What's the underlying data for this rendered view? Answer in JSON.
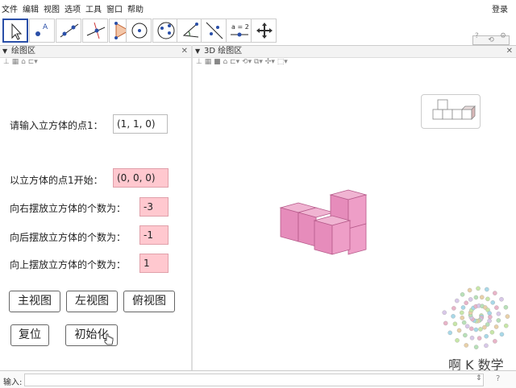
{
  "menu": [
    "文件",
    "编辑",
    "视图",
    "选项",
    "工具",
    "窗口",
    "帮助"
  ],
  "login_label": "登录",
  "toolbar": {
    "tools": [
      "move-tool",
      "point-tool",
      "line-tool",
      "perpendicular-tool",
      "polygon-tool",
      "circle-tool",
      "conic-tool",
      "angle-tool",
      "reflect-tool",
      "slider-tool",
      "move-view-tool"
    ],
    "slider_text": "a = 2"
  },
  "left_panel": {
    "title": "绘图区"
  },
  "right_panel": {
    "title": "3D 绘图区"
  },
  "form": {
    "cube_point_label": "请输入立方体的点1：",
    "cube_point_value": "(1, 1, 0)",
    "start_label": "以立方体的点1开始：",
    "start_value": "(0, 0, 0)",
    "right_label": "向右摆放立方体的个数为：",
    "right_value": "-3",
    "back_label": "向后摆放立方体的个数为：",
    "back_value": "-1",
    "up_label": "向上摆放立方体的个数为：",
    "up_value": "1"
  },
  "buttons": {
    "front_view": "主视图",
    "left_view": "左视图",
    "top_view": "俯视图",
    "reset": "复位",
    "init": "初始化"
  },
  "input_bar": {
    "label": "输入:"
  },
  "brand": "啊 K 数学",
  "colors": {
    "cube_fill": "#e89ac0",
    "field_pink": "#ffc8cf",
    "active_tool": "#2a4fa8"
  }
}
